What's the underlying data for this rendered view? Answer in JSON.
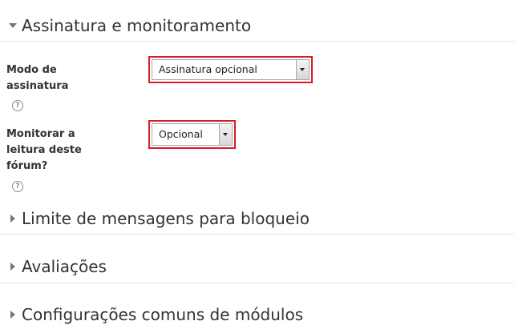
{
  "sections": {
    "subscription": {
      "title": "Assinatura e monitoramento",
      "expanded": true,
      "arrow_icon": "triangle-down-icon"
    },
    "post_limit": {
      "title": "Limite de mensagens para bloqueio",
      "expanded": false,
      "arrow_icon": "triangle-right-icon"
    },
    "ratings": {
      "title": "Avaliações",
      "expanded": false,
      "arrow_icon": "triangle-right-icon"
    },
    "common_module": {
      "title": "Configurações comuns de módulos",
      "expanded": false,
      "arrow_icon": "triangle-right-icon"
    }
  },
  "fields": {
    "subscription_mode": {
      "label_line1": "Modo de",
      "label_line2": "assinatura",
      "value": "Assinatura opcional",
      "help_icon": "question-circle-icon"
    },
    "track_reading": {
      "label_line1": "Monitorar a",
      "label_line2": "leitura deste",
      "label_line3": "fórum?",
      "value": "Opcional",
      "help_icon": "question-circle-icon"
    }
  },
  "colors": {
    "highlight_border": "#d81c24",
    "text": "#333333",
    "divider": "#e3e3e3",
    "arrow": "#777777"
  }
}
